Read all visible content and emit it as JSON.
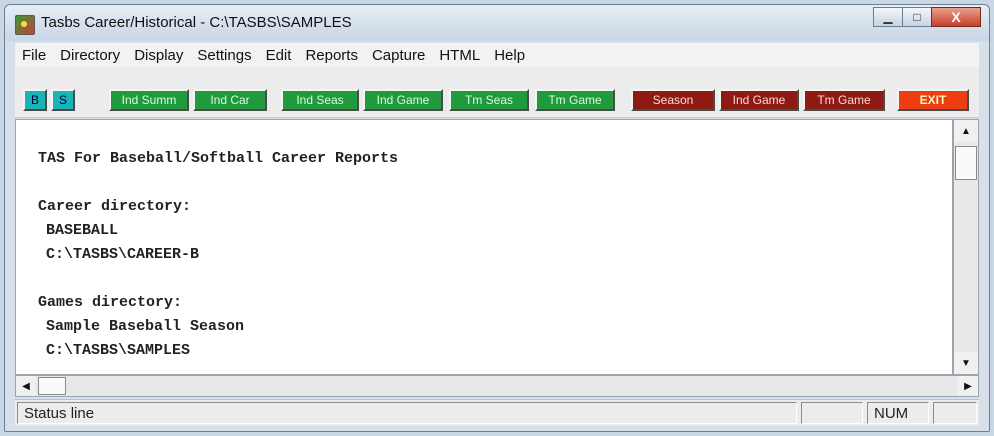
{
  "window": {
    "title": "Tasbs Career/Historical - C:\\TASBS\\SAMPLES",
    "minimize_icon": "minimize-icon",
    "maximize_icon": "maximize-icon",
    "close_label": "X"
  },
  "menu": [
    "File",
    "Directory",
    "Display",
    "Settings",
    "Edit",
    "Reports",
    "Capture",
    "HTML",
    "Help"
  ],
  "toolbar": {
    "b": "B",
    "s": "S",
    "ind_summ": "Ind Summ",
    "ind_car": "Ind Car",
    "ind_seas": "Ind Seas",
    "ind_game_green": "Ind Game",
    "tm_seas": "Tm Seas",
    "tm_game_green": "Tm Game",
    "season": "Season",
    "ind_game_red": "Ind Game",
    "tm_game_red": "Tm Game",
    "exit": "EXIT"
  },
  "content": {
    "heading": "TAS For Baseball/Softball Career Reports",
    "career_label": "Career directory:",
    "career_name": "BASEBALL",
    "career_path": "C:\\TASBS\\CAREER-B",
    "games_label": "Games directory:",
    "games_name": "Sample Baseball Season",
    "games_path": "C:\\TASBS\\SAMPLES"
  },
  "status": {
    "line": "Status line",
    "num": "NUM"
  },
  "colors": {
    "cyan_button": "#1ab4b8",
    "green_button": "#1f9a3c",
    "red_button": "#8e1a14",
    "exit_button": "#ec3e12"
  }
}
